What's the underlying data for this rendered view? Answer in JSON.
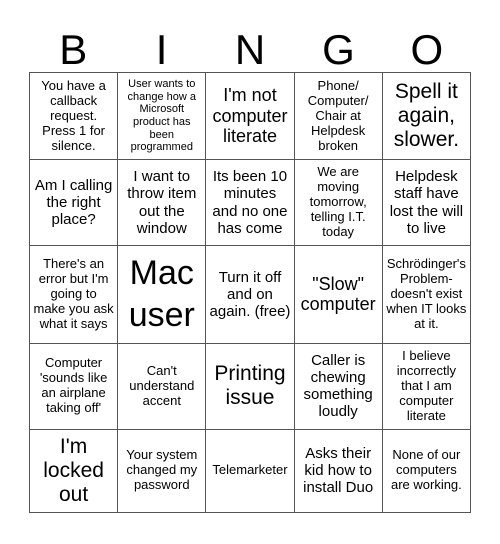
{
  "header": [
    "B",
    "I",
    "N",
    "G",
    "O"
  ],
  "rows": [
    [
      {
        "text": "You have a callback request. Press 1 for silence.",
        "size": "s-sm"
      },
      {
        "text": "User wants to change how a Microsoft product has been programmed",
        "size": "s-xs"
      },
      {
        "text": "I'm not computer literate",
        "size": "s-lg"
      },
      {
        "text": "Phone/ Computer/ Chair at Helpdesk broken",
        "size": "s-sm"
      },
      {
        "text": "Spell it again, slower.",
        "size": "s-xl"
      }
    ],
    [
      {
        "text": "Am I calling the right place?",
        "size": "s-md"
      },
      {
        "text": "I want to throw item out the window",
        "size": "s-md"
      },
      {
        "text": "Its been 10 minutes and no one has come",
        "size": "s-md"
      },
      {
        "text": "We are moving tomorrow, telling I.T. today",
        "size": "s-sm"
      },
      {
        "text": "Helpdesk staff have lost the will to live",
        "size": "s-md"
      }
    ],
    [
      {
        "text": "There's an error but I'm going to make you ask what it says",
        "size": "s-sm"
      },
      {
        "text": "Mac user",
        "size": "s-xxl"
      },
      {
        "text": "Turn it off and on again. (free)",
        "size": "s-md"
      },
      {
        "text": "\"Slow\" computer",
        "size": "s-lg"
      },
      {
        "text": "Schrödinger's Problem- doesn't exist when IT looks at it.",
        "size": "s-sm"
      }
    ],
    [
      {
        "text": "Computer 'sounds like an airplane taking off'",
        "size": "s-sm"
      },
      {
        "text": "Can't understand accent",
        "size": "s-sm"
      },
      {
        "text": "Printing issue",
        "size": "s-xl"
      },
      {
        "text": "Caller is chewing something loudly",
        "size": "s-md"
      },
      {
        "text": "I believe incorrectly that I am computer literate",
        "size": "s-sm"
      }
    ],
    [
      {
        "text": "I'm locked out",
        "size": "s-xl"
      },
      {
        "text": "Your system changed my password",
        "size": "s-sm"
      },
      {
        "text": "Telemarketer",
        "size": "s-sm"
      },
      {
        "text": "Asks their kid how to install Duo",
        "size": "s-md"
      },
      {
        "text": "None of our computers are working.",
        "size": "s-sm"
      }
    ]
  ]
}
